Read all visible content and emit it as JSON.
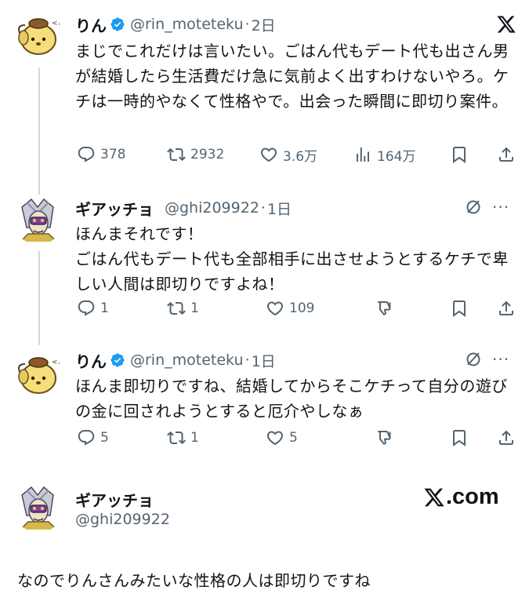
{
  "posts": [
    {
      "name": "りん",
      "handle": "@rin_moteteku",
      "time": "2日",
      "verified": true,
      "avatar": "pompompurin-avatar",
      "text": "まじでこれだけは言いたい。ごはん代もデート代も出さん男が結婚したら生活費だけ急に気前よく出すわけないやろ。ケチは一時的やなくて性格やで。出会った瞬間に即切り案件。",
      "replies": "378",
      "reposts": "2932",
      "likes": "3.6万",
      "views": "164万"
    },
    {
      "name": "ギアッチョ",
      "handle": "@ghi209922",
      "time": "1日",
      "verified": false,
      "avatar": "ghiaccio-avatar",
      "text": "ほんまそれです！\nごはん代もデート代も全部相手に出させようとするケチで卑しい人間は即切りですよね！",
      "replies": "1",
      "reposts": "1",
      "likes": "109"
    },
    {
      "name": "りん",
      "handle": "@rin_moteteku",
      "time": "1日",
      "verified": true,
      "avatar": "pompompurin-avatar",
      "text": "ほんま即切りですね、結婚してからそこケチって自分の遊びの金に回されようとすると厄介やしなぁ",
      "replies": "5",
      "reposts": "1",
      "likes": "5"
    }
  ],
  "card": {
    "name": "ギアッチョ",
    "handle": "@ghi209922",
    "brand": "X.com"
  },
  "caption": "なのでりんさんみたいな性格の人は即切りですね",
  "colors": {
    "text": "#0f1419",
    "muted": "#536471",
    "verified": "#1d9bf0",
    "line": "#cfd9de"
  }
}
